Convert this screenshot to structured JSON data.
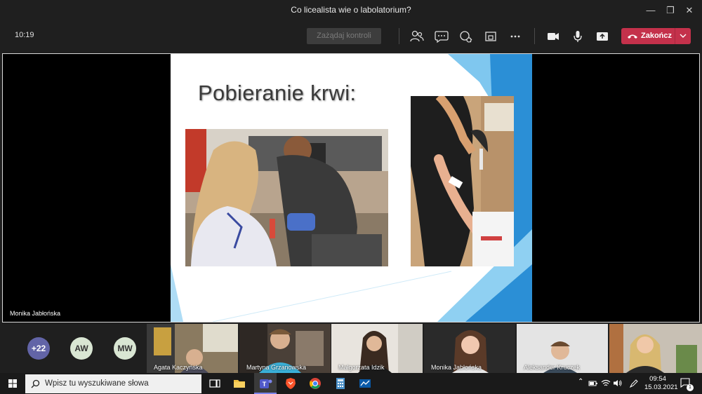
{
  "window": {
    "title": "Co licealista wie o labolatorium?"
  },
  "toolbar": {
    "clock": "10:19",
    "request_control": "Zażądaj kontroli",
    "end_call": "Zakończ"
  },
  "stage": {
    "presenter": "Monika Jabłońska",
    "slide_title": "Pobieranie krwi:"
  },
  "participants": {
    "overflow": "+22",
    "avatars": [
      "AW",
      "MW"
    ],
    "tiles": [
      {
        "name": "Agata Kaczyńska"
      },
      {
        "name": "Martyna Grzanowska"
      },
      {
        "name": "Małgorzata Idzik"
      },
      {
        "name": "Monika Jabłońska"
      },
      {
        "name": "Aleksander Kruczek"
      },
      {
        "name": ""
      }
    ]
  },
  "taskbar": {
    "search_placeholder": "Wpisz tu wyszukiwane słowa",
    "time": "09:54",
    "date": "15.03.2021",
    "notifications": "1"
  },
  "colors": {
    "end_call": "#c4314b",
    "overflow_avatar": "#6264a7",
    "slide_accent": "#2b8fd6"
  },
  "icons": [
    "participants-icon",
    "chat-icon",
    "reactions-icon",
    "rooms-icon",
    "more-icon",
    "camera-icon",
    "mic-icon",
    "share-icon",
    "phone-icon",
    "windows-icon",
    "search-icon",
    "task-view-icon",
    "file-explorer-icon",
    "teams-icon",
    "brave-icon",
    "chrome-icon",
    "calculator-icon",
    "whiteboard-icon"
  ]
}
